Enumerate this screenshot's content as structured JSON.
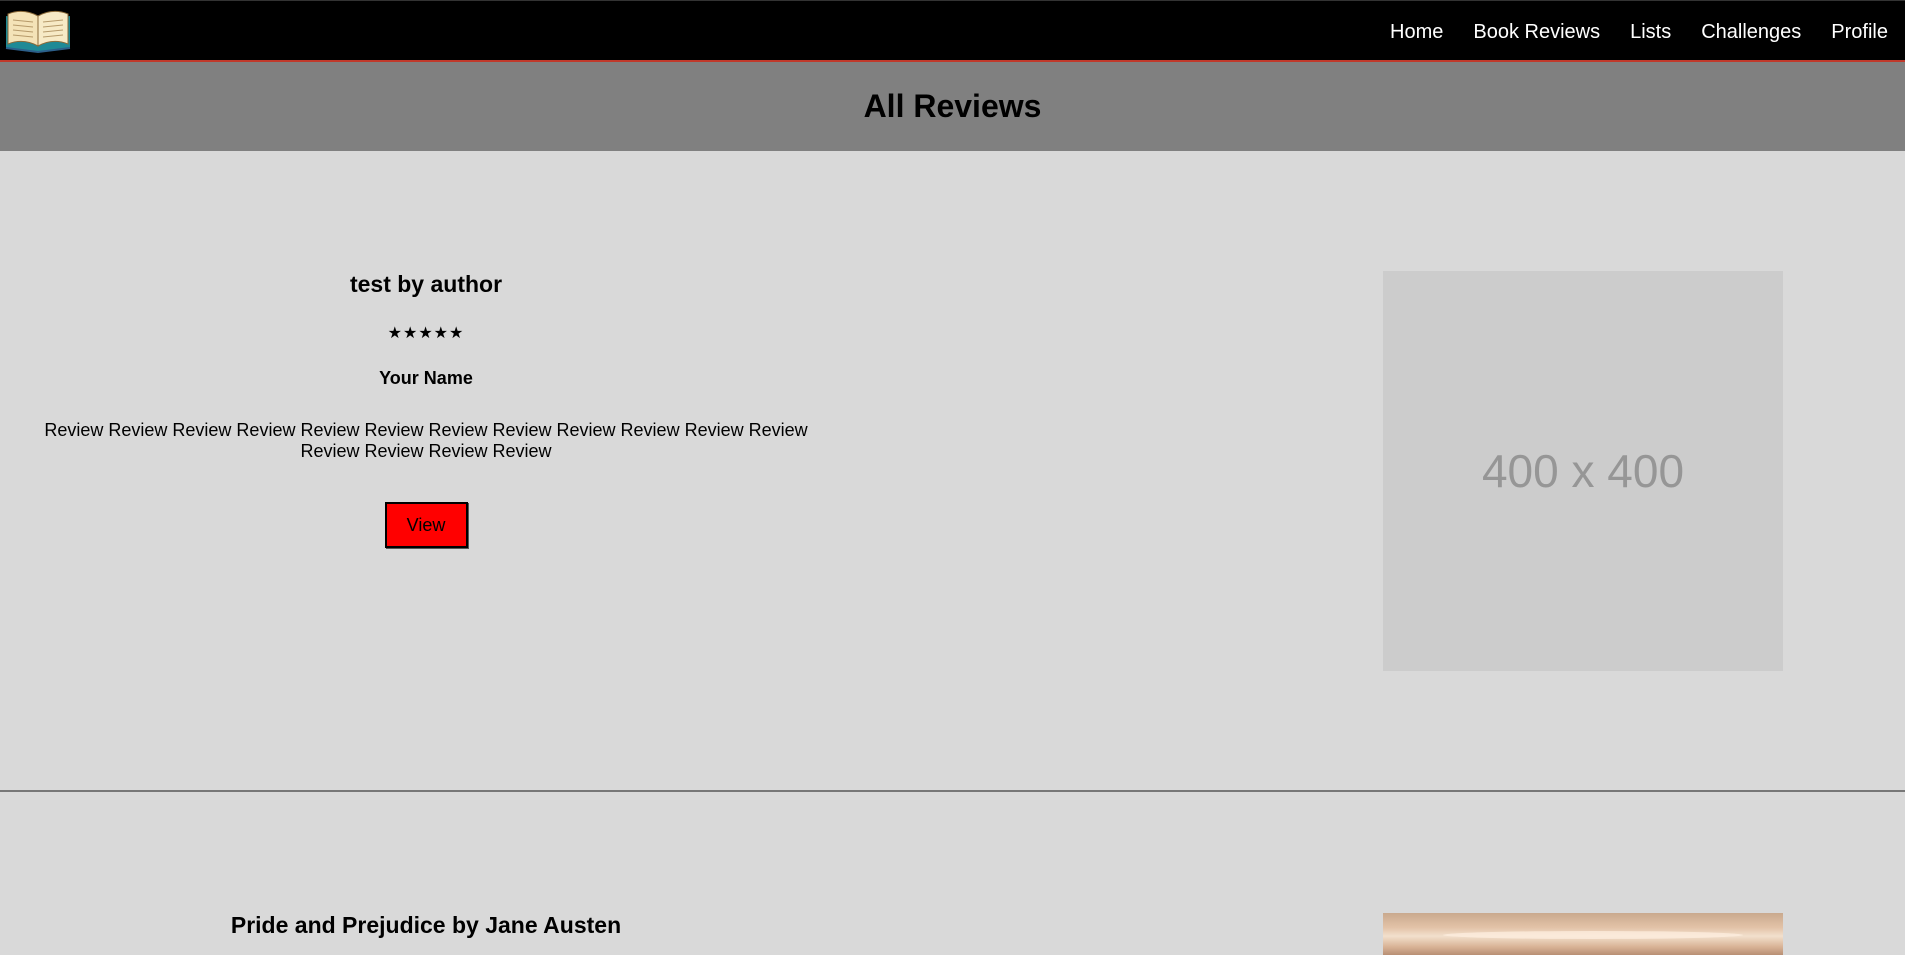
{
  "nav": {
    "logo_icon": "open-book-icon",
    "items": [
      {
        "label": "Home"
      },
      {
        "label": "Book Reviews"
      },
      {
        "label": "Lists"
      },
      {
        "label": "Challenges"
      },
      {
        "label": "Profile"
      }
    ]
  },
  "page": {
    "title": "All Reviews"
  },
  "reviews": [
    {
      "title": "test by author",
      "stars": "★★★★★",
      "reviewer": "Your Name",
      "body": "Review Review Review Review Review Review Review Review Review Review Review Review Review Review Review Review",
      "button_label": "View",
      "image_text": "400 x 400"
    },
    {
      "title": "Pride and Prejudice by Jane Austen"
    }
  ],
  "colors": {
    "nav_bg": "#000000",
    "title_band": "#808080",
    "page_bg": "#d9d9d9",
    "button": "#ff0000",
    "nav_border": "#c0392b"
  }
}
